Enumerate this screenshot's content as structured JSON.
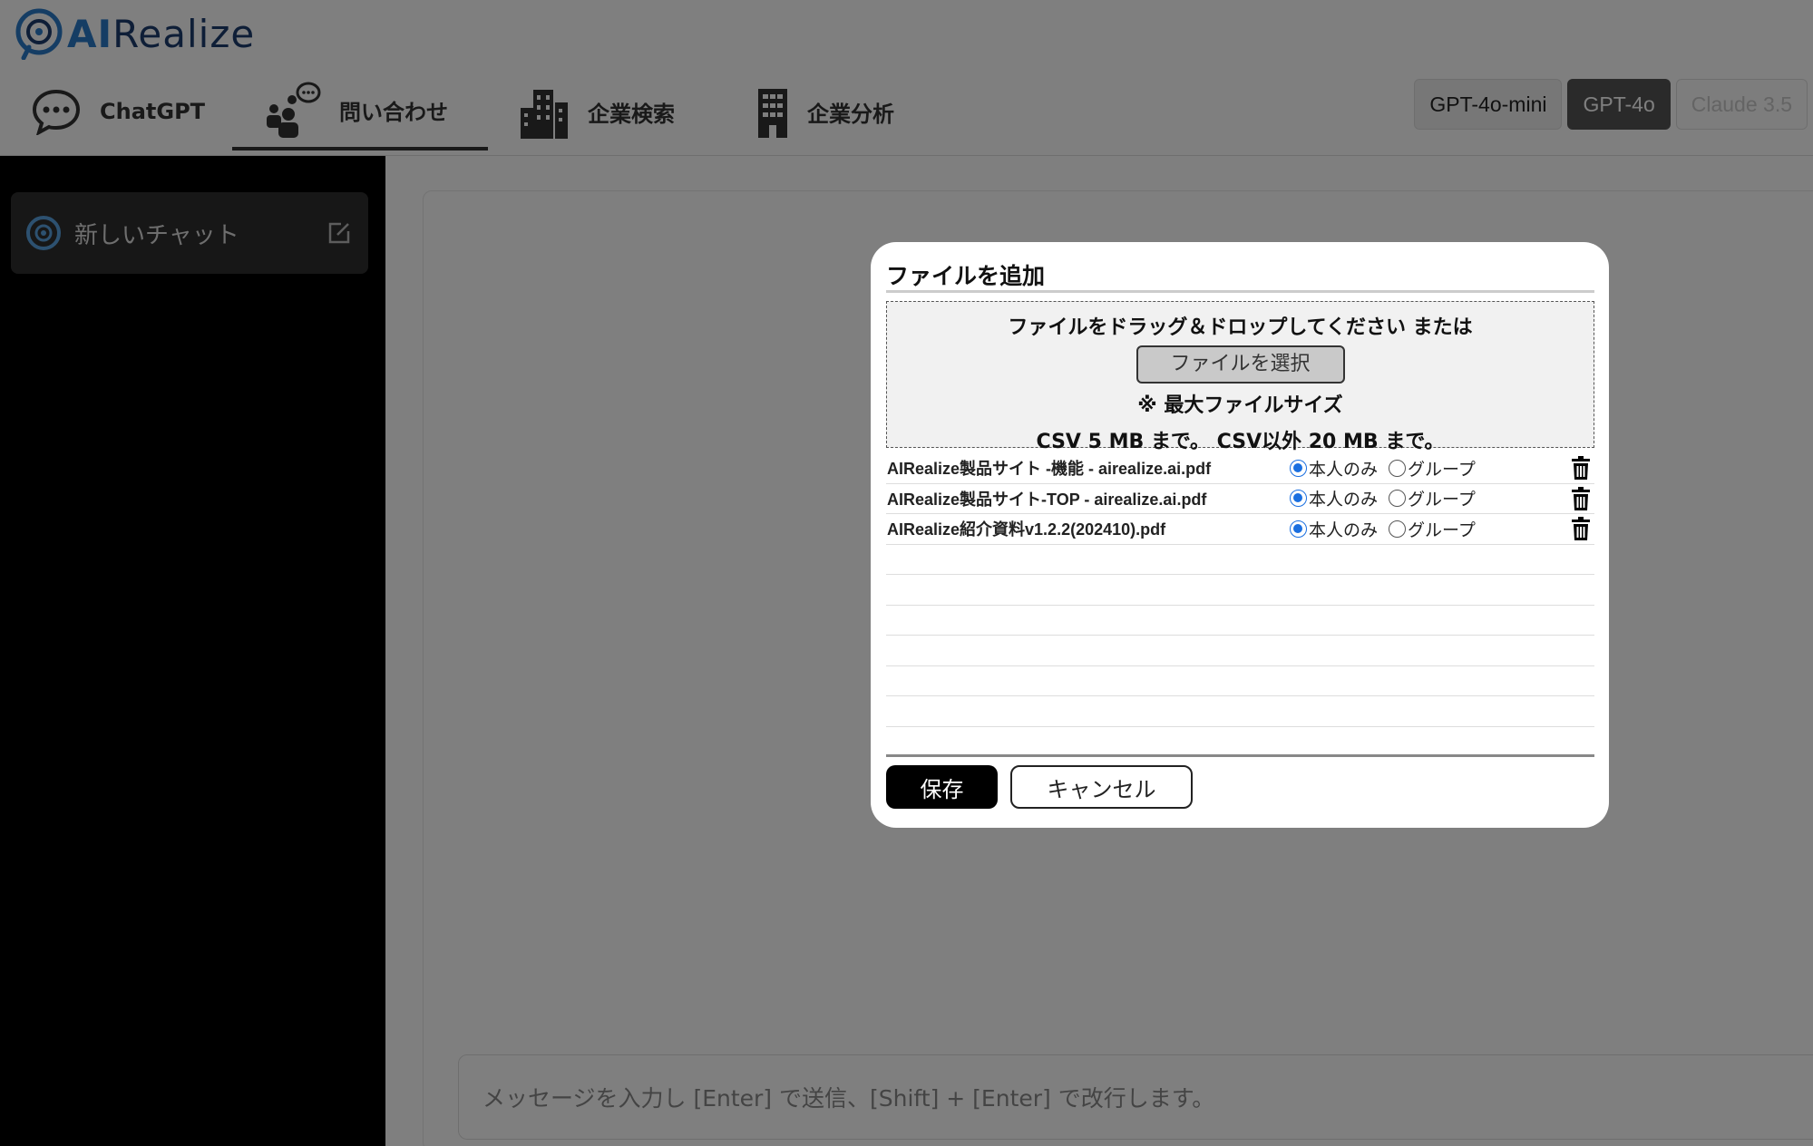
{
  "app": {
    "logo_prefix": "AI",
    "logo_suffix": "Realize"
  },
  "nav": {
    "tabs": [
      {
        "label": "ChatGPT",
        "icon": "chat-bubble-icon"
      },
      {
        "label": "問い合わせ",
        "icon": "people-chat-icon",
        "active": true
      },
      {
        "label": "企業検索",
        "icon": "city-buildings-icon"
      },
      {
        "label": "企業分析",
        "icon": "office-building-icon"
      }
    ]
  },
  "models": {
    "items": [
      {
        "label": "GPT-4o-mini",
        "state": "normal"
      },
      {
        "label": "GPT-4o",
        "state": "active"
      },
      {
        "label": "Claude 3.5",
        "state": "disabled"
      }
    ]
  },
  "sidebar": {
    "new_chat_label": "新しいチャット"
  },
  "composer": {
    "placeholder": "メッセージを入力し [Enter] で送信、[Shift] + [Enter] で改行します。"
  },
  "modal": {
    "title": "ファイルを追加",
    "drop_text": "ファイルをドラッグ＆ドロップしてください または",
    "select_button": "ファイルを選択",
    "max_size_note": "※ 最大ファイルサイズ",
    "size_limits": "CSV 5 MB まで。 CSV以外 20 MB まで。",
    "radio_self": "本人のみ",
    "radio_group": "グループ",
    "files": [
      {
        "name": "AIRealize製品サイト -機能 - airealize.ai.pdf",
        "visibility": "本人のみ"
      },
      {
        "name": "AIRealize製品サイト-TOP - airealize.ai.pdf",
        "visibility": "本人のみ"
      },
      {
        "name": "AIRealize紹介資料v1.2.2(202410).pdf",
        "visibility": "本人のみ"
      }
    ],
    "save_label": "保存",
    "cancel_label": "キャンセル"
  },
  "colors": {
    "overlay": "rgba(0,0,0,0.5)",
    "radio_selected": "#1a6fe0",
    "logo_accent": "#2a7bc8",
    "logo_dark": "#1c3d6e"
  }
}
